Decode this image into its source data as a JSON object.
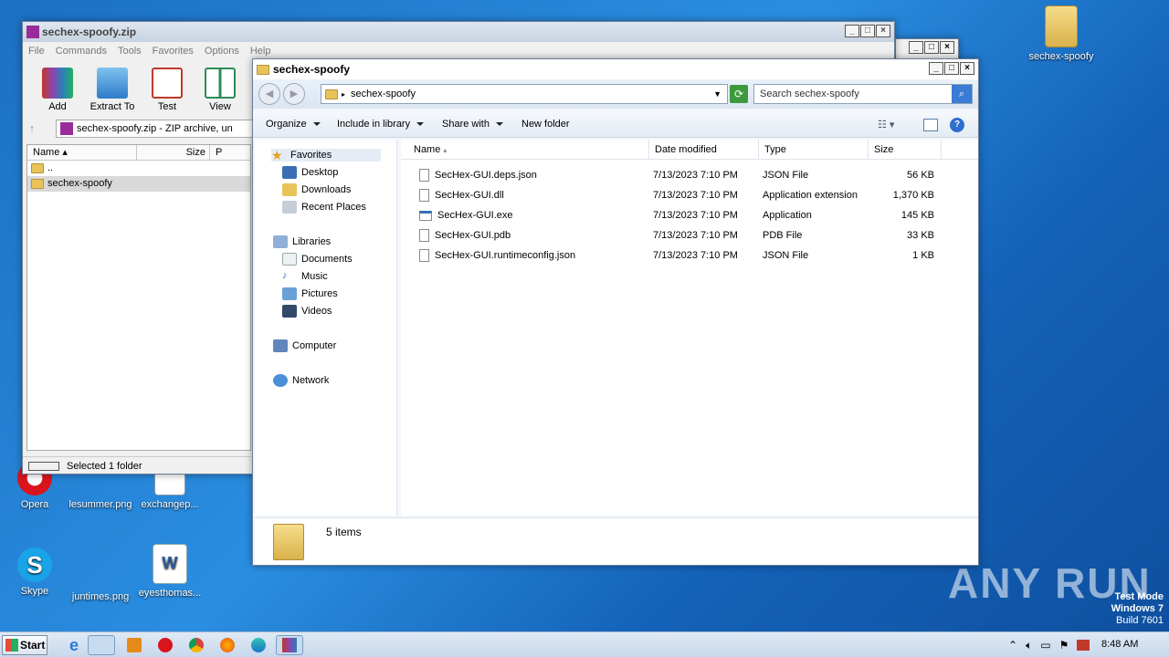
{
  "desktop": {
    "icons": [
      {
        "label": "Opera"
      },
      {
        "label": "lesummer.png"
      },
      {
        "label": "exchangep..."
      },
      {
        "label": "Skype"
      },
      {
        "label": "juntimes.png"
      },
      {
        "label": "eyesthomas..."
      },
      {
        "label": "sechex-spoofy"
      }
    ],
    "watermark": "ANY RUN",
    "os_notice": [
      "Test Mode",
      "Windows 7",
      "Build 7601"
    ]
  },
  "winrar": {
    "title": "sechex-spoofy.zip",
    "menu": [
      "File",
      "Commands",
      "Tools",
      "Favorites",
      "Options",
      "Help"
    ],
    "toolbar": [
      {
        "label": "Add",
        "icon": "add-archive-icon"
      },
      {
        "label": "Extract To",
        "icon": "extract-icon"
      },
      {
        "label": "Test",
        "icon": "test-icon"
      },
      {
        "label": "View",
        "icon": "view-icon"
      }
    ],
    "path": "sechex-spoofy.zip - ZIP archive, un",
    "columns": [
      "Name",
      "Size",
      "P"
    ],
    "rows": [
      "..",
      "sechex-spoofy"
    ],
    "status": "Selected 1 folder"
  },
  "explorer": {
    "title": "sechex-spoofy",
    "address": "sechex-spoofy",
    "search_placeholder": "Search sechex-spoofy",
    "commands": {
      "organize": "Organize",
      "include": "Include in library",
      "share": "Share with",
      "new_folder": "New folder"
    },
    "nav": {
      "favorites": "Favorites",
      "desktop": "Desktop",
      "downloads": "Downloads",
      "recent": "Recent Places",
      "libraries": "Libraries",
      "documents": "Documents",
      "music": "Music",
      "pictures": "Pictures",
      "videos": "Videos",
      "computer": "Computer",
      "network": "Network"
    },
    "columns": {
      "name": "Name",
      "date": "Date modified",
      "type": "Type",
      "size": "Size"
    },
    "files": [
      {
        "name": "SecHex-GUI.deps.json",
        "date": "7/13/2023 7:10 PM",
        "type": "JSON File",
        "size": "56 KB"
      },
      {
        "name": "SecHex-GUI.dll",
        "date": "7/13/2023 7:10 PM",
        "type": "Application extension",
        "size": "1,370 KB"
      },
      {
        "name": "SecHex-GUI.exe",
        "date": "7/13/2023 7:10 PM",
        "type": "Application",
        "size": "145 KB"
      },
      {
        "name": "SecHex-GUI.pdb",
        "date": "7/13/2023 7:10 PM",
        "type": "PDB File",
        "size": "33 KB"
      },
      {
        "name": "SecHex-GUI.runtimeconfig.json",
        "date": "7/13/2023 7:10 PM",
        "type": "JSON File",
        "size": "1 KB"
      }
    ],
    "item_count": "5 items"
  },
  "taskbar": {
    "start": "Start",
    "clock": "8:48 AM"
  }
}
